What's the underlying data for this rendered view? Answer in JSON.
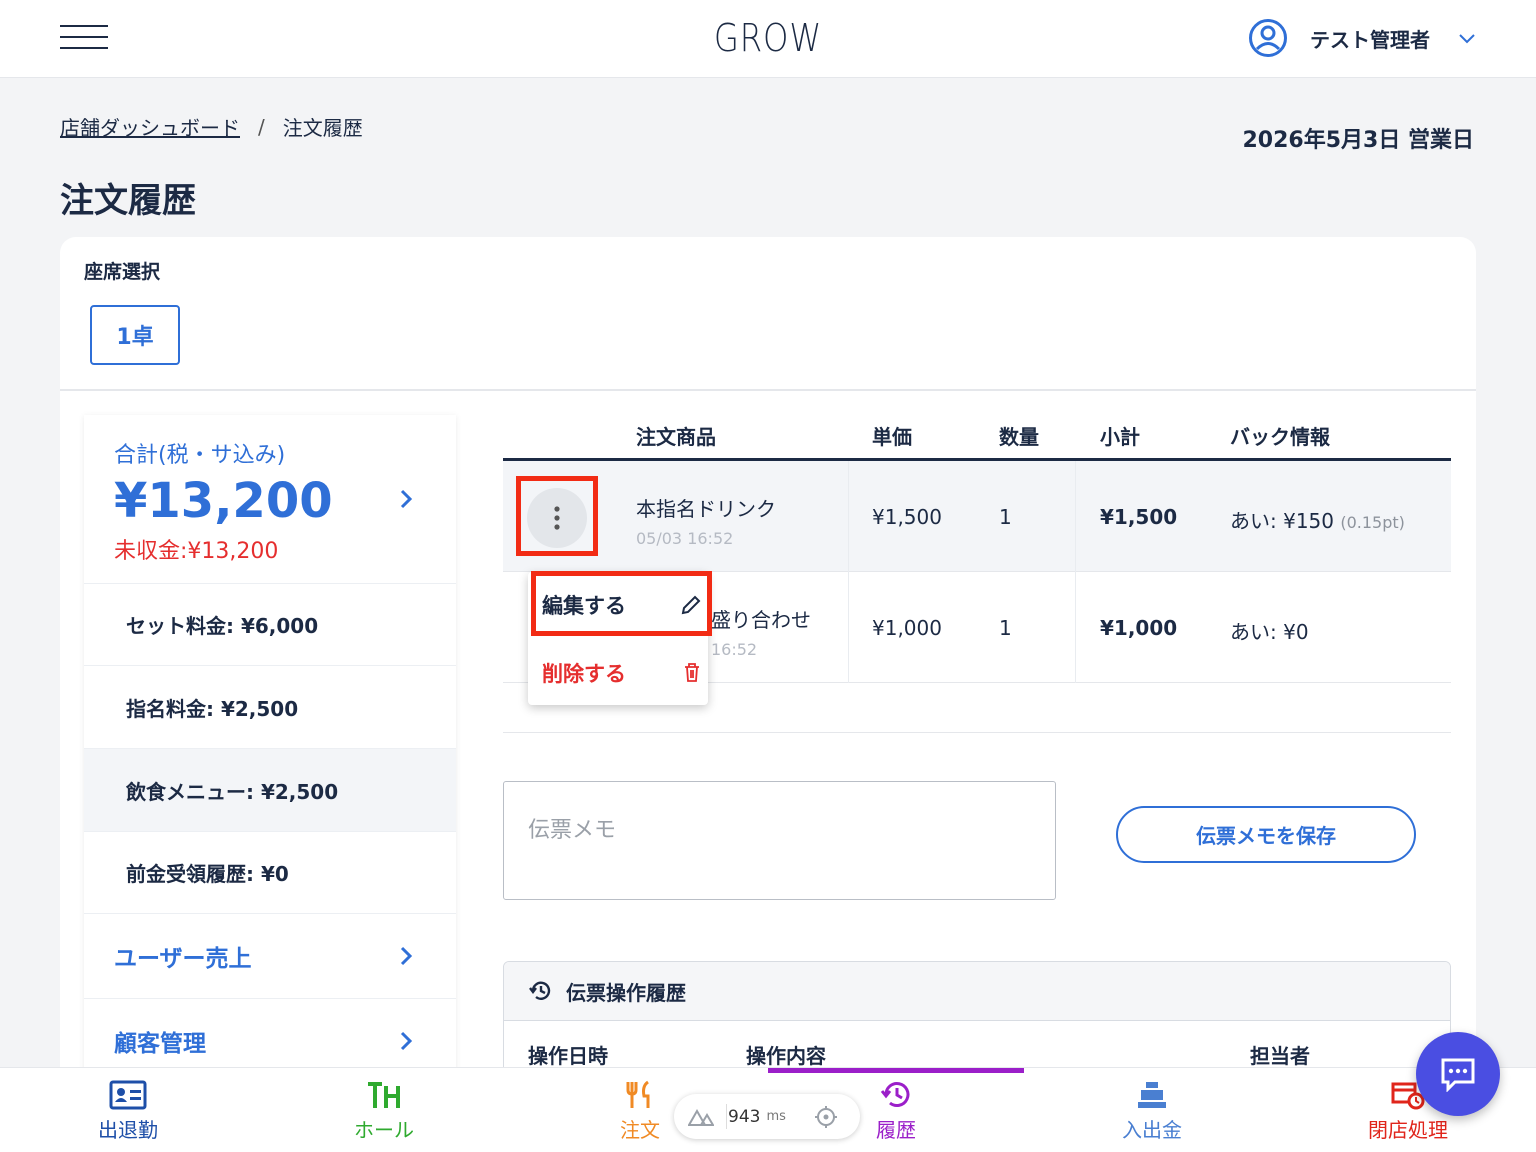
{
  "header": {
    "brand": "GROW",
    "user_name": "テスト管理者"
  },
  "breadcrumb": {
    "home": "店舗ダッシュボード",
    "separator": "/",
    "current": "注文履歴"
  },
  "business_date": "2026年5月3日 営業日",
  "page_title": "注文履歴",
  "seat": {
    "label": "座席選択",
    "selected": "1卓"
  },
  "summary": {
    "total_label": "合計(税・サ込み)",
    "total_amount": "¥13,200",
    "unpaid": "未収金:¥13,200",
    "rows": [
      "セット料金: ¥6,000",
      "指名料金: ¥2,500",
      "飲食メニュー: ¥2,500",
      "前金受領履歴: ¥0"
    ],
    "links": [
      "ユーザー売上",
      "顧客管理"
    ]
  },
  "orders": {
    "headers": [
      "注文商品",
      "単価",
      "数量",
      "小計",
      "バック情報"
    ],
    "rows": [
      {
        "name": "本指名ドリンク",
        "time": "05/03 16:52",
        "price": "¥1,500",
        "qty": "1",
        "subtotal": "¥1,500",
        "back": "あい: ¥150",
        "back_pt": "(0.15pt)"
      },
      {
        "name": "盛り合わせ",
        "time": "16:52",
        "price": "¥1,000",
        "qty": "1",
        "subtotal": "¥1,000",
        "back": "あい: ¥0",
        "back_pt": ""
      }
    ]
  },
  "row_menu": {
    "edit": "編集する",
    "delete": "削除する"
  },
  "memo": {
    "placeholder": "伝票メモ",
    "save": "伝票メモを保存"
  },
  "op_history": {
    "title": "伝票操作履歴",
    "columns": [
      "操作日時",
      "操作内容",
      "担当者"
    ]
  },
  "bottom_nav": [
    {
      "label": "出退勤",
      "color": "#1e4fa8"
    },
    {
      "label": "ホール",
      "color": "#2faa2f"
    },
    {
      "label": "注文",
      "color": "#f08a24"
    },
    {
      "label": "履歴",
      "color": "#9b1fc9"
    },
    {
      "label": "入出金",
      "color": "#4a7fd1"
    },
    {
      "label": "閉店処理",
      "color": "#e0251b"
    }
  ],
  "perf": {
    "value": "943",
    "unit": "ms"
  },
  "colors": {
    "accent": "#2f6fd7",
    "danger": "#e52e2e",
    "highlight": "#f22b14",
    "active_tab": "#9b1fc9",
    "chat": "#4a4ee2"
  }
}
